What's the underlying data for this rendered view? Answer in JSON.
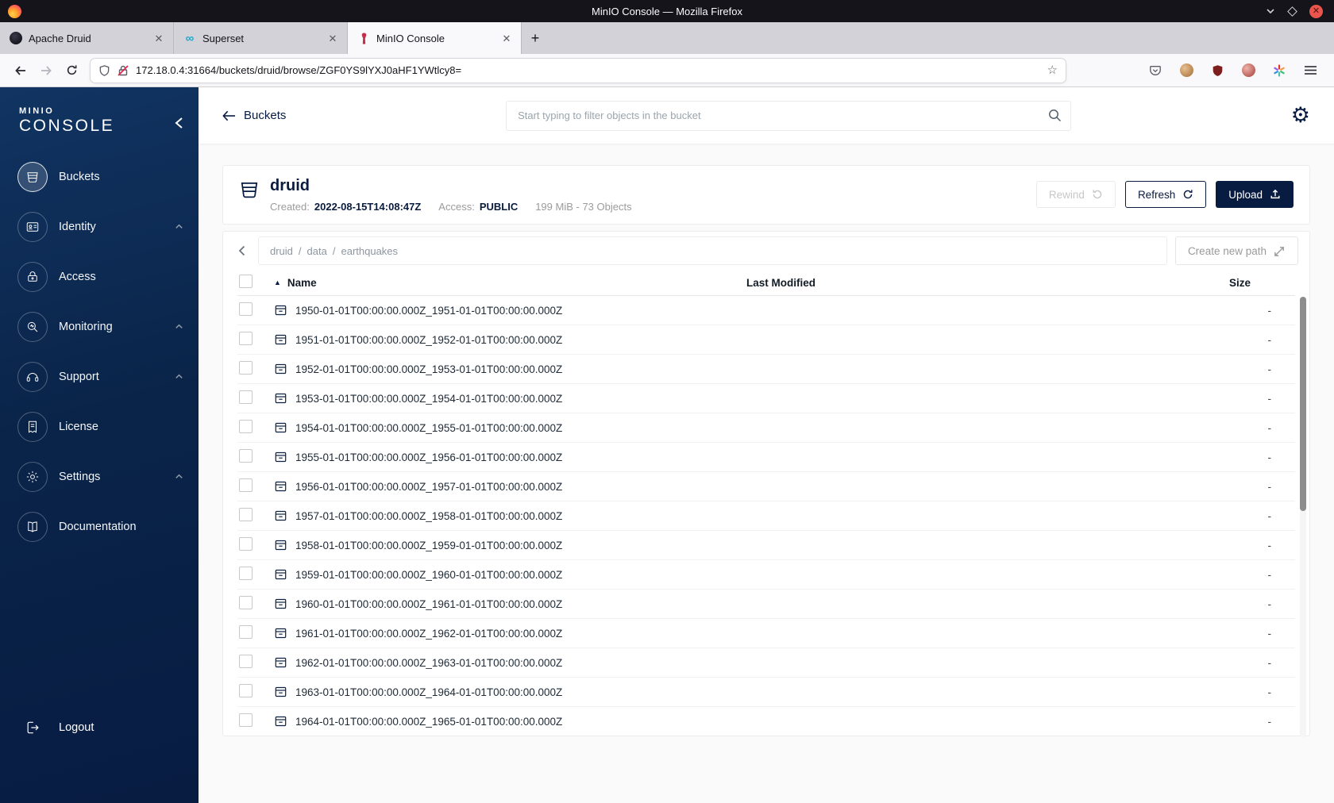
{
  "window": {
    "title": "MinIO Console — Mozilla Firefox"
  },
  "browser": {
    "tabs": [
      {
        "label": "Apache Druid"
      },
      {
        "label": "Superset"
      },
      {
        "label": "MinIO Console"
      }
    ],
    "url": "172.18.0.4:31664/buckets/druid/browse/ZGF0YS9lYXJ0aHF1YWtlcy8="
  },
  "sidebar": {
    "logo_line1": "MINIO",
    "logo_line2": "CONSOLE",
    "items": [
      {
        "label": "Buckets"
      },
      {
        "label": "Identity"
      },
      {
        "label": "Access"
      },
      {
        "label": "Monitoring"
      },
      {
        "label": "Support"
      },
      {
        "label": "License"
      },
      {
        "label": "Settings"
      },
      {
        "label": "Documentation"
      }
    ],
    "logout_label": "Logout"
  },
  "header": {
    "back_label": "Buckets",
    "search_placeholder": "Start typing to filter objects in the bucket"
  },
  "bucket": {
    "name": "druid",
    "created_label": "Created:",
    "created_value": "2022-08-15T14:08:47Z",
    "access_label": "Access:",
    "access_value": "PUBLIC",
    "usage": "199 MiB - 73 Objects",
    "rewind_label": "Rewind",
    "refresh_label": "Refresh",
    "upload_label": "Upload"
  },
  "browse": {
    "breadcrumb": {
      "parts": [
        "druid",
        "data",
        "earthquakes"
      ],
      "separator": "/"
    },
    "create_path_label": "Create new path",
    "columns": {
      "name": "Name",
      "last_modified": "Last Modified",
      "size": "Size"
    },
    "rows": [
      {
        "name": "1950-01-01T00:00:00.000Z_1951-01-01T00:00:00.000Z",
        "size": "-"
      },
      {
        "name": "1951-01-01T00:00:00.000Z_1952-01-01T00:00:00.000Z",
        "size": "-"
      },
      {
        "name": "1952-01-01T00:00:00.000Z_1953-01-01T00:00:00.000Z",
        "size": "-"
      },
      {
        "name": "1953-01-01T00:00:00.000Z_1954-01-01T00:00:00.000Z",
        "size": "-"
      },
      {
        "name": "1954-01-01T00:00:00.000Z_1955-01-01T00:00:00.000Z",
        "size": "-"
      },
      {
        "name": "1955-01-01T00:00:00.000Z_1956-01-01T00:00:00.000Z",
        "size": "-"
      },
      {
        "name": "1956-01-01T00:00:00.000Z_1957-01-01T00:00:00.000Z",
        "size": "-"
      },
      {
        "name": "1957-01-01T00:00:00.000Z_1958-01-01T00:00:00.000Z",
        "size": "-"
      },
      {
        "name": "1958-01-01T00:00:00.000Z_1959-01-01T00:00:00.000Z",
        "size": "-"
      },
      {
        "name": "1959-01-01T00:00:00.000Z_1960-01-01T00:00:00.000Z",
        "size": "-"
      },
      {
        "name": "1960-01-01T00:00:00.000Z_1961-01-01T00:00:00.000Z",
        "size": "-"
      },
      {
        "name": "1961-01-01T00:00:00.000Z_1962-01-01T00:00:00.000Z",
        "size": "-"
      },
      {
        "name": "1962-01-01T00:00:00.000Z_1963-01-01T00:00:00.000Z",
        "size": "-"
      },
      {
        "name": "1963-01-01T00:00:00.000Z_1964-01-01T00:00:00.000Z",
        "size": "-"
      },
      {
        "name": "1964-01-01T00:00:00.000Z_1965-01-01T00:00:00.000Z",
        "size": "-"
      }
    ]
  }
}
